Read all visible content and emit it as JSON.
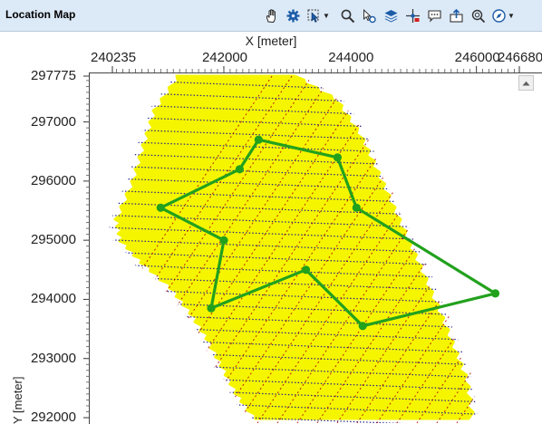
{
  "window": {
    "title": "Location Map"
  },
  "toolbar": [
    {
      "name": "pan-hand-icon",
      "has_menu": false
    },
    {
      "name": "gear-icon",
      "has_menu": false
    },
    {
      "name": "select-zoom-icon",
      "has_menu": true
    },
    {
      "name": "magnifier-icon",
      "has_menu": false
    },
    {
      "name": "pick-cursor-icon",
      "has_menu": false
    },
    {
      "name": "layers-icon",
      "has_menu": false
    },
    {
      "name": "crosshair-icon",
      "has_menu": false
    },
    {
      "name": "comment-icon",
      "has_menu": false
    },
    {
      "name": "export-icon",
      "has_menu": false
    },
    {
      "name": "zoom-fit-icon",
      "has_menu": false
    },
    {
      "name": "compass-icon",
      "has_menu": true
    }
  ],
  "map": {
    "x_axis_label": "X [meter]",
    "y_axis_label": "Y [meter]",
    "x_ticks": [
      "240235",
      "242000",
      "244000",
      "246000",
      "246680"
    ],
    "y_ticks": [
      "297775",
      "297000",
      "296000",
      "295000",
      "294000",
      "293000",
      "292000"
    ],
    "survey_color": "#f5f500",
    "polygon_color": "#22a11d",
    "receiver_line_color": "#1a1a8c",
    "source_line_color": "#b00000",
    "polygon_points_xy_meter": [
      [
        242550,
        296700
      ],
      [
        242250,
        296200
      ],
      [
        241000,
        295550
      ],
      [
        242000,
        295000
      ],
      [
        241800,
        293850
      ],
      [
        243300,
        294500
      ],
      [
        244200,
        293550
      ],
      [
        246300,
        294100
      ],
      [
        244100,
        295550
      ],
      [
        243800,
        296400
      ]
    ]
  }
}
